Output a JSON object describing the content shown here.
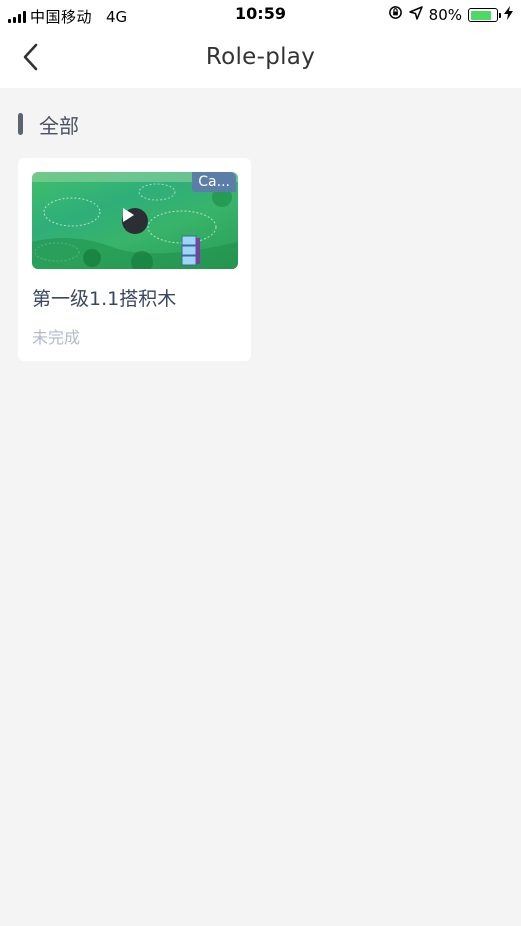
{
  "status_bar": {
    "carrier": "中国移动",
    "network": "4G",
    "time": "10:59",
    "battery_percent": "80%",
    "battery_level": 0.8,
    "icons": [
      "signal-icon",
      "orientation-lock-icon",
      "location-icon",
      "battery-icon",
      "charging-icon"
    ]
  },
  "header": {
    "title": "Role-play",
    "back_icon": "chevron-left-icon"
  },
  "section": {
    "title": "全部"
  },
  "cards": [
    {
      "title": "第一级1.1搭积木",
      "status": "未完成",
      "tag": "Ca...",
      "play_icon": "play-icon"
    }
  ],
  "colors": {
    "background": "#f4f4f4",
    "surface": "#ffffff",
    "section_bar": "#5c6470",
    "title_text": "#3b4660",
    "muted_text": "#b3b9c8",
    "tag_bg": "#5b7ea8",
    "battery_fill": "#4cd964"
  }
}
